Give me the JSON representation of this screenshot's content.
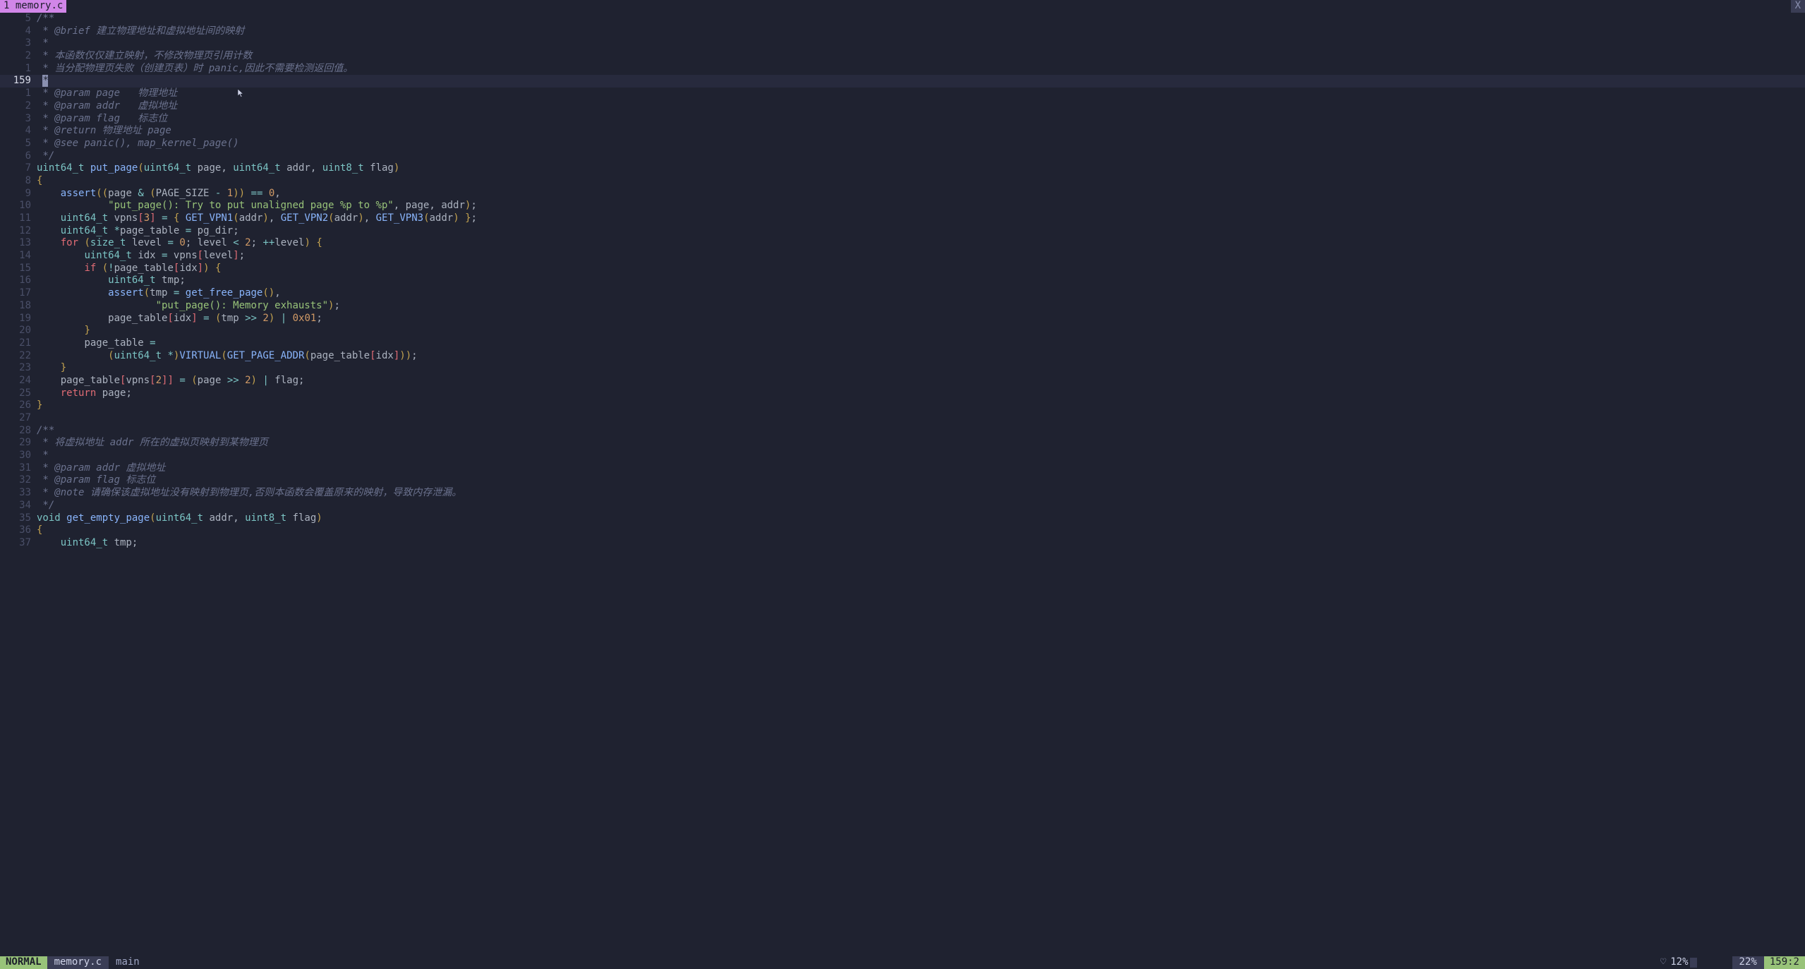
{
  "tab": {
    "index": "1",
    "name": "memory.c",
    "close": "X"
  },
  "status": {
    "mode": "NORMAL",
    "file": "memory.c",
    "branch": "main",
    "heart": "♡",
    "pct1": "12%",
    "pct2": "22%",
    "pos": "159:2"
  },
  "current_line_abs": "159",
  "lines": [
    {
      "g": "5",
      "h": "<span class='cmt'>/**</span>"
    },
    {
      "g": "4",
      "h": "<span class='cmt'> * @brief 建立物理地址和虚拟地址间的映射</span>"
    },
    {
      "g": "3",
      "h": "<span class='cmt'> *</span>"
    },
    {
      "g": "2",
      "h": "<span class='cmt'> * 本函数仅仅建立映射，不修改物理页引用计数</span>"
    },
    {
      "g": "1",
      "h": "<span class='cmt'> * 当分配物理页失败（创建页表）时 panic,因此不需要检测返回值。</span>"
    },
    {
      "g": "159",
      "cur": true,
      "h": " <span class='cursor-cell'>*</span>"
    },
    {
      "g": "1",
      "h": "<span class='cmt'> * @param page   物理地址</span>"
    },
    {
      "g": "2",
      "h": "<span class='cmt'> * @param addr   虚拟地址</span>"
    },
    {
      "g": "3",
      "h": "<span class='cmt'> * @param flag   标志位</span>"
    },
    {
      "g": "4",
      "h": "<span class='cmt'> * @return 物理地址 page</span>"
    },
    {
      "g": "5",
      "h": "<span class='cmt'> * @see panic(), map_kernel_page()</span>"
    },
    {
      "g": "6",
      "h": "<span class='cmt'> */</span>"
    },
    {
      "g": "7",
      "h": "<span class='typ'>uint64_t</span> <span class='fn'>put_page</span><span class='br'>(</span><span class='typ'>uint64_t</span> <span class='id'>page</span><span class='pk'>,</span> <span class='typ'>uint64_t</span> <span class='id'>addr</span><span class='pk'>,</span> <span class='typ'>uint8_t</span> <span class='id'>flag</span><span class='br'>)</span>"
    },
    {
      "g": "8",
      "h": "<span class='br'>{</span>"
    },
    {
      "g": "9",
      "h": "    <span class='fn'>assert</span><span class='br'>((</span><span class='id'>page</span> <span class='op'>&amp;</span> <span class='br'>(</span><span class='id'>PAGE_SIZE</span> <span class='op'>-</span> <span class='num'>1</span><span class='br'>))</span> <span class='op'>==</span> <span class='num'>0</span><span class='pk'>,</span>"
    },
    {
      "g": "10",
      "h": "            <span class='str'>\"put_page(): Try to put unaligned page %p to %p\"</span><span class='pk'>,</span> <span class='id'>page</span><span class='pk'>,</span> <span class='id'>addr</span><span class='br'>)</span><span class='pk'>;</span>"
    },
    {
      "g": "11",
      "h": "    <span class='typ'>uint64_t</span> <span class='id'>vpns</span><span class='ctl'>[</span><span class='num'>3</span><span class='ctl'>]</span> <span class='op'>=</span> <span class='br'>{</span> <span class='fn'>GET_VPN1</span><span class='br'>(</span><span class='id'>addr</span><span class='br'>)</span><span class='pk'>,</span> <span class='fn'>GET_VPN2</span><span class='br'>(</span><span class='id'>addr</span><span class='br'>)</span><span class='pk'>,</span> <span class='fn'>GET_VPN3</span><span class='br'>(</span><span class='id'>addr</span><span class='br'>)</span> <span class='br'>}</span><span class='pk'>;</span>"
    },
    {
      "g": "12",
      "h": "    <span class='typ'>uint64_t</span> <span class='op'>*</span><span class='id'>page_table</span> <span class='op'>=</span> <span class='id'>pg_dir</span><span class='pk'>;</span>"
    },
    {
      "g": "13",
      "h": "    <span class='ctl'>for</span> <span class='br'>(</span><span class='typ'>size_t</span> <span class='id'>level</span> <span class='op'>=</span> <span class='num'>0</span><span class='pk'>;</span> <span class='id'>level</span> <span class='op'>&lt;</span> <span class='num'>2</span><span class='pk'>;</span> <span class='op'>++</span><span class='id'>level</span><span class='br'>)</span> <span class='br'>{</span>"
    },
    {
      "g": "14",
      "h": "        <span class='typ'>uint64_t</span> <span class='id'>idx</span> <span class='op'>=</span> <span class='id'>vpns</span><span class='ctl'>[</span><span class='id'>level</span><span class='ctl'>]</span><span class='pk'>;</span>"
    },
    {
      "g": "15",
      "h": "        <span class='ctl'>if</span> <span class='br'>(</span><span class='op'>!</span><span class='id'>page_table</span><span class='ctl'>[</span><span class='id'>idx</span><span class='ctl'>]</span><span class='br'>)</span> <span class='br'>{</span>"
    },
    {
      "g": "16",
      "h": "            <span class='typ'>uint64_t</span> <span class='id'>tmp</span><span class='pk'>;</span>"
    },
    {
      "g": "17",
      "h": "            <span class='fn'>assert</span><span class='br'>(</span><span class='id'>tmp</span> <span class='op'>=</span> <span class='fn'>get_free_page</span><span class='br'>()</span><span class='pk'>,</span>"
    },
    {
      "g": "18",
      "h": "                    <span class='str'>\"put_page(): Memory exhausts\"</span><span class='br'>)</span><span class='pk'>;</span>"
    },
    {
      "g": "19",
      "h": "            <span class='id'>page_table</span><span class='ctl'>[</span><span class='id'>idx</span><span class='ctl'>]</span> <span class='op'>=</span> <span class='br'>(</span><span class='id'>tmp</span> <span class='op'>&gt;&gt;</span> <span class='num'>2</span><span class='br'>)</span> <span class='op'>|</span> <span class='num'>0x01</span><span class='pk'>;</span>"
    },
    {
      "g": "20",
      "h": "        <span class='br'>}</span>"
    },
    {
      "g": "21",
      "h": "        <span class='id'>page_table</span> <span class='op'>=</span>"
    },
    {
      "g": "22",
      "h": "            <span class='br'>(</span><span class='typ'>uint64_t</span> <span class='op'>*</span><span class='br'>)</span><span class='fn'>VIRTUAL</span><span class='br'>(</span><span class='fn'>GET_PAGE_ADDR</span><span class='br'>(</span><span class='id'>page_table</span><span class='ctl'>[</span><span class='id'>idx</span><span class='ctl'>]</span><span class='br'>))</span><span class='pk'>;</span>"
    },
    {
      "g": "23",
      "h": "    <span class='br'>}</span>"
    },
    {
      "g": "24",
      "h": "    <span class='id'>page_table</span><span class='ctl'>[</span><span class='id'>vpns</span><span class='ctl'>[</span><span class='num'>2</span><span class='ctl'>]]</span> <span class='op'>=</span> <span class='br'>(</span><span class='id'>page</span> <span class='op'>&gt;&gt;</span> <span class='num'>2</span><span class='br'>)</span> <span class='op'>|</span> <span class='id'>flag</span><span class='pk'>;</span>"
    },
    {
      "g": "25",
      "h": "    <span class='ctl'>return</span> <span class='id'>page</span><span class='pk'>;</span>"
    },
    {
      "g": "26",
      "h": "<span class='br'>}</span>"
    },
    {
      "g": "27",
      "h": ""
    },
    {
      "g": "28",
      "h": "<span class='cmt'>/**</span>"
    },
    {
      "g": "29",
      "h": "<span class='cmt'> * 将虚拟地址 addr 所在的虚拟页映射到某物理页</span>"
    },
    {
      "g": "30",
      "h": "<span class='cmt'> *</span>"
    },
    {
      "g": "31",
      "h": "<span class='cmt'> * @param addr 虚拟地址</span>"
    },
    {
      "g": "32",
      "h": "<span class='cmt'> * @param flag 标志位</span>"
    },
    {
      "g": "33",
      "h": "<span class='cmt'> * @note 请确保该虚拟地址没有映射到物理页,否则本函数会覆盖原来的映射，导致内存泄漏。</span>"
    },
    {
      "g": "34",
      "h": "<span class='cmt'> */</span>"
    },
    {
      "g": "35",
      "h": "<span class='typ'>void</span> <span class='fn'>get_empty_page</span><span class='br'>(</span><span class='typ'>uint64_t</span> <span class='id'>addr</span><span class='pk'>,</span> <span class='typ'>uint8_t</span> <span class='id'>flag</span><span class='br'>)</span>"
    },
    {
      "g": "36",
      "h": "<span class='br'>{</span>"
    },
    {
      "g": "37",
      "h": "    <span class='typ'>uint64_t</span> <span class='id'>tmp</span><span class='pk'>;</span>"
    }
  ]
}
